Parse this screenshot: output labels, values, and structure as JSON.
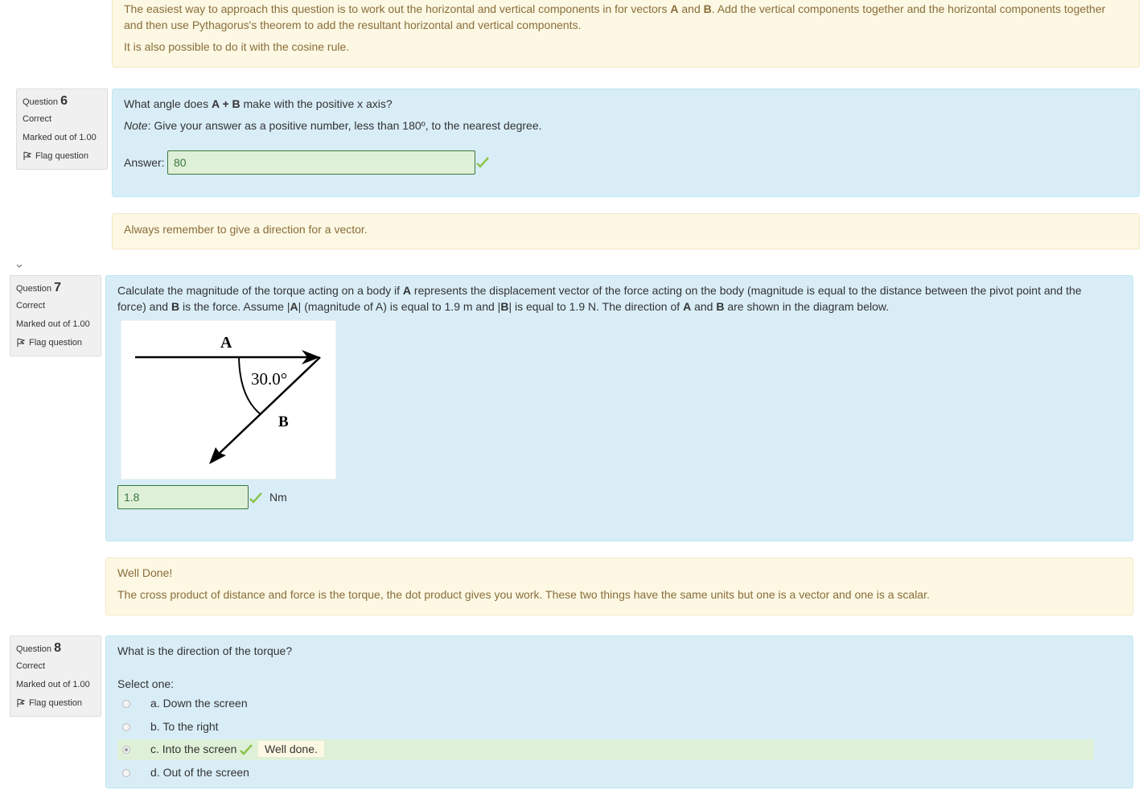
{
  "prev_feedback": {
    "line1a": "The easiest way to approach this question is to work out the horizontal and vertical components in for vectors ",
    "a": "A",
    "and": " and ",
    "b": "B",
    "line1b": ". Add the vertical components together and the horizontal components together",
    "line2": "and then use Pythagorus's theorem to add the resultant horizontal and vertical components.",
    "line3": "It is also possible to do it with the cosine rule."
  },
  "q6": {
    "label": "Question",
    "number": "6",
    "state": "Correct",
    "mark": "Marked out of 1.00",
    "flag": "Flag question",
    "text_pre": "What angle does ",
    "text_bold": "A + B",
    "text_post": " make with the positive x axis?",
    "note_label": "Note",
    "note_text": ": Give your answer as a positive number, less than 180º, to the nearest degree.",
    "answer_label": "Answer:",
    "answer_value": "80",
    "feedback": "Always remember to give a direction for a vector."
  },
  "q7": {
    "label": "Question",
    "number": "7",
    "state": "Correct",
    "mark": "Marked out of 1.00",
    "flag": "Flag question",
    "t1": "Calculate the magnitude of the torque acting on a body if ",
    "t_a": "A",
    "t2": " represents the displacement vector of the force acting on the body (magnitude is equal to the distance between the pivot point and the",
    "t3": "force) and ",
    "t_b": "B",
    "t4": " is the force. Assume |",
    "t_a2": "A",
    "t5": "| (magnitude of A) is equal to 1.9 m and |",
    "t_b2": "B",
    "t6": "| is equal to 1.9 N. The direction of ",
    "t_a3": "A",
    "t7": " and ",
    "t_b3": "B",
    "t8": " are shown in the diagram below.",
    "diagram": {
      "label_a": "A",
      "label_b": "B",
      "angle": "30.0°"
    },
    "answer_value": "1.8",
    "unit": "Nm",
    "feedback_title": "Well Done!",
    "feedback_text": "The cross product of distance and force is the torque, the dot product gives you work. These two things have the same units but one is a vector and one is a scalar."
  },
  "q8": {
    "label": "Question",
    "number": "8",
    "state": "Correct",
    "mark": "Marked out of 1.00",
    "flag": "Flag question",
    "text": "What is the direction of the torque?",
    "select_one": "Select one:",
    "options": [
      {
        "label": "a. Down the screen",
        "checked": false
      },
      {
        "label": "b. To the right",
        "checked": false
      },
      {
        "label": "c. Into the screen",
        "checked": true
      },
      {
        "label": "d. Out of the screen",
        "checked": false
      }
    ],
    "option_feedback": "Well done."
  },
  "colors": {
    "correct_green": "#8bc34a",
    "feedback_bg": "#fcf8e3",
    "formulation_bg": "#d9edf7"
  }
}
